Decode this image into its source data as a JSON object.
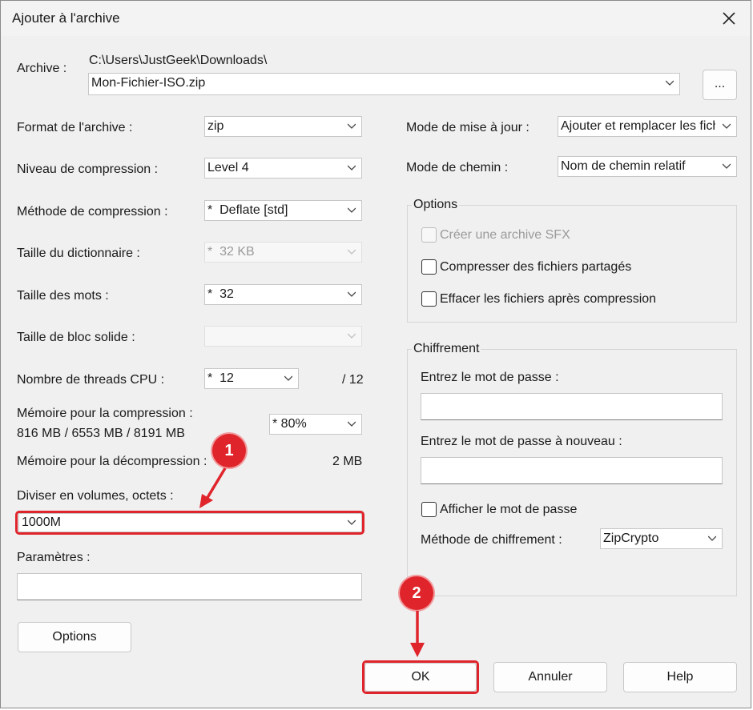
{
  "window": {
    "title": "Ajouter à l'archive"
  },
  "archive": {
    "label": "Archive :",
    "path": "C:\\Users\\JustGeek\\Downloads\\",
    "filename": "Mon-Fichier-ISO.zip",
    "browse_label": "..."
  },
  "left": {
    "format": {
      "label": "Format de l'archive :",
      "value": "zip"
    },
    "level": {
      "label": "Niveau de compression :",
      "value": "Level 4"
    },
    "method": {
      "label": "Méthode de compression :",
      "value": "*  Deflate [std]"
    },
    "dict": {
      "label": "Taille du dictionnaire :",
      "value": "*  32 KB"
    },
    "words": {
      "label": "Taille des mots :",
      "value": "*  32"
    },
    "solid": {
      "label": "Taille de bloc solide :",
      "value": ""
    },
    "threads": {
      "label": "Nombre de threads CPU :",
      "value": "*  12",
      "max": "/ 12"
    },
    "mem_comp": {
      "label": "Mémoire pour la compression :",
      "detail": "816 MB / 6553 MB / 8191 MB",
      "value": "* 80%"
    },
    "mem_decomp": {
      "label": "Mémoire pour la décompression :",
      "value": "2 MB"
    },
    "split": {
      "label": "Diviser en volumes, octets :",
      "value": "1000M"
    },
    "params": {
      "label": "Paramètres :",
      "value": ""
    },
    "options_button": "Options"
  },
  "right": {
    "update_mode": {
      "label": "Mode de mise à jour :",
      "value": "Ajouter et remplacer les fichiers"
    },
    "path_mode": {
      "label": "Mode de chemin :",
      "value": "Nom de chemin relatif"
    },
    "options_group": {
      "title": "Options",
      "sfx": "Créer une archive SFX",
      "shared": "Compresser des fichiers partagés",
      "delete": "Effacer les fichiers après compression"
    },
    "encryption": {
      "title": "Chiffrement",
      "password_label": "Entrez le mot de passe :",
      "password_again_label": "Entrez le mot de passe à nouveau :",
      "show_password": "Afficher le mot de passe",
      "method_label": "Méthode de chiffrement :",
      "method_value": "ZipCrypto"
    }
  },
  "footer": {
    "ok": "OK",
    "cancel": "Annuler",
    "help": "Help"
  },
  "annotations": {
    "badge1": "1",
    "badge2": "2",
    "color": "#e0242b"
  }
}
